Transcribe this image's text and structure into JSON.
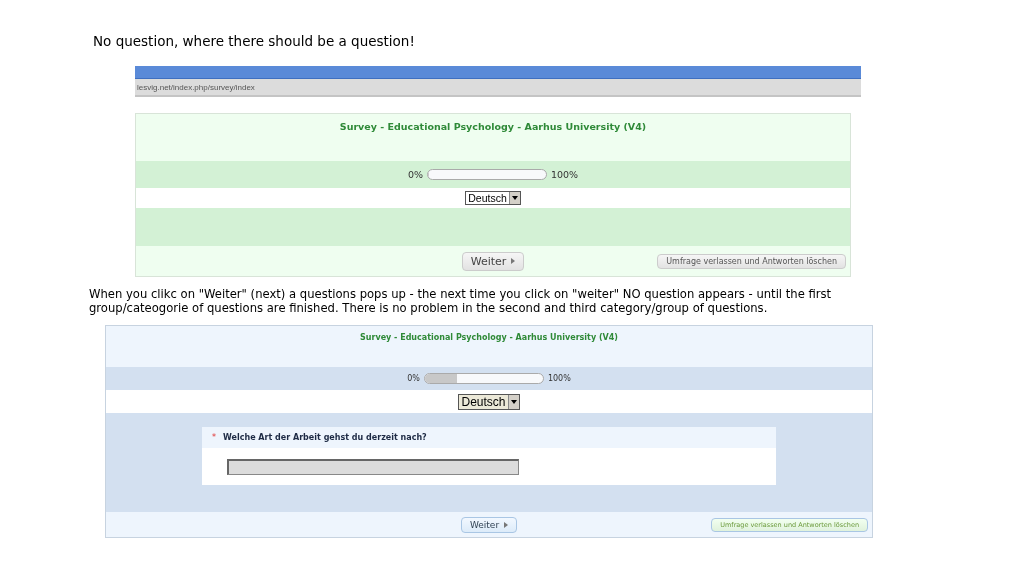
{
  "heading": "No question, where there should be a question!",
  "captures": [
    {
      "kind": "green",
      "url": "lesvig.net/index.php/survey/index",
      "title": "Survey - Educational Psychology - Aarhus University (V4)",
      "progress": {
        "start": "0%",
        "end": "100%",
        "level": 0
      },
      "language": "Deutsch",
      "next_button": "Weiter",
      "exit_button": "Umfrage verlassen und Antworten löschen"
    },
    {
      "kind": "blue",
      "title": "Survey - Educational Psychology - Aarhus University (V4)",
      "progress": {
        "start": "0%",
        "end": "100%",
        "level": 0.27
      },
      "language": "Deutsch",
      "question": {
        "required": true,
        "mark": "*",
        "text": "Welche Art der Arbeit gehst du derzeit nach?"
      },
      "next_button": "Weiter",
      "exit_button": "Umfrage verlassen und Antworten löschen"
    }
  ],
  "explanation": "When you clikc on \"Weiter\" (next) a questions pops up - the next time you click on \"weiter\" NO question appears - until the first group/cateogorie of questions are finished. There is no problem in the second and third category/group of questions."
}
